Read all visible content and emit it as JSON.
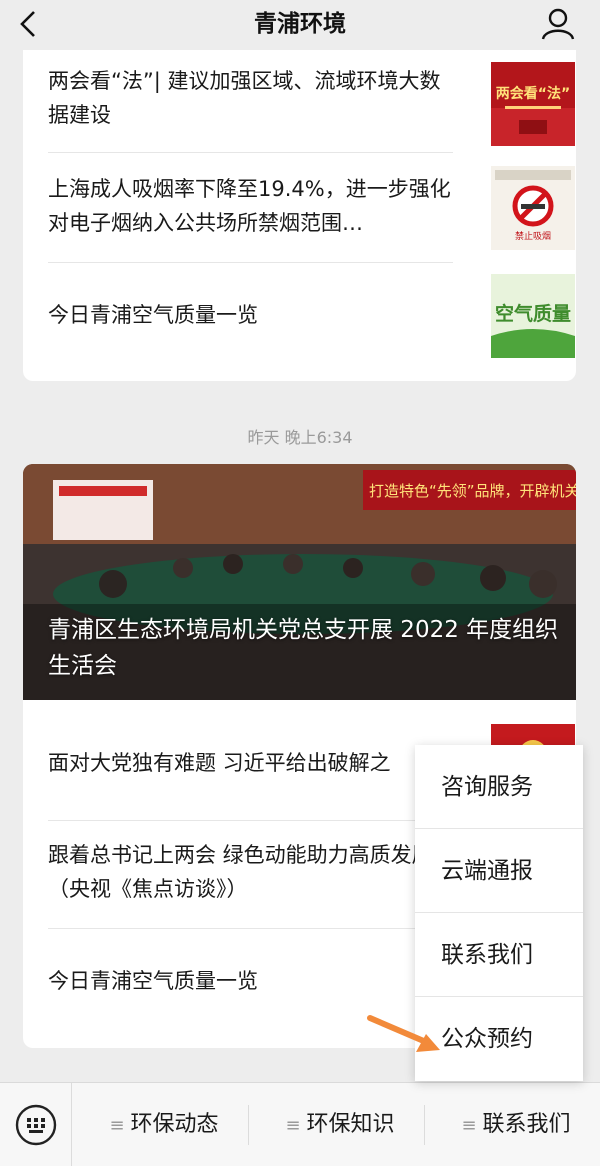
{
  "header": {
    "title": "青浦环境"
  },
  "card1": {
    "items": [
      {
        "text": "两会看“法”| 建议加强区域、流域环境大数据建设",
        "thumb_text": "两会看“法”"
      },
      {
        "text": "上海成人吸烟率下降至19.4%，进一步强化对电子烟纳入公共场所禁烟范围…",
        "thumb_text": "禁止吸烟"
      },
      {
        "text": "今日青浦空气质量一览",
        "thumb_text": "空气质量"
      }
    ]
  },
  "timestamp": "昨天 晚上6:34",
  "card2": {
    "hero_title": "青浦区生态环境局机关党总支开展 2022 年度组织生活会",
    "hero_banner": "打造特色“先领”品牌，开辟机关",
    "items": [
      {
        "text": "面对大党独有难题 习近平给出破解之"
      },
      {
        "text": "跟着总书记上两会 绿色动能助力高质发展（央视《焦点访谈》）"
      },
      {
        "text": "今日青浦空气质量一览"
      }
    ]
  },
  "menu": {
    "items": [
      "咨询服务",
      "云端通报",
      "联系我们",
      "公众预约"
    ]
  },
  "bottom_bar": {
    "tabs": [
      "环保动态",
      "环保知识",
      "联系我们"
    ]
  },
  "colors": {
    "accent_arrow": "#f28a3a",
    "background": "#ededed"
  }
}
